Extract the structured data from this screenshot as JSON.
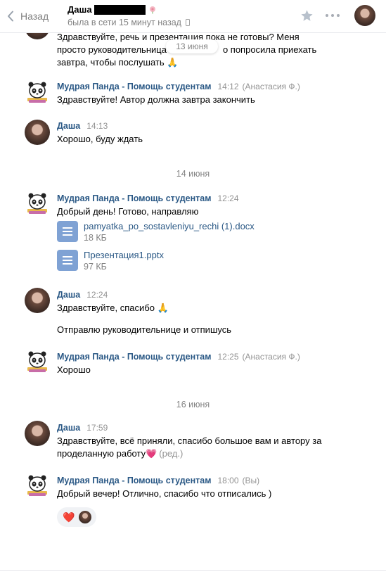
{
  "header": {
    "back_label": "Назад",
    "peer_name": "Даша",
    "status": "была в сети 15 минут назад"
  },
  "floating_date": "13 июня",
  "top_message": {
    "line1": "Здравствуйте, речь и презентация пока не готовы? Меня",
    "line2": "просто руководительница",
    "line2_tail": "о попросила приехать",
    "line3": "завтра, чтобы послушать 🙏"
  },
  "messages": [
    {
      "author": "Мудрая Панда - Помощь студентам",
      "time": "14:12",
      "sub": "(Анастасия Ф.)",
      "text": "Здравствуйте! Автор должна завтра закончить"
    },
    {
      "author": "Даша",
      "time": "14:13",
      "text": "Хорошо, буду ждать"
    },
    {
      "author": "Мудрая Панда - Помощь студентам",
      "time": "12:24",
      "text": "Добрый день! Готово, направляю"
    },
    {
      "author": "Даша",
      "time": "12:24",
      "text": "Здравствуйте, спасибо 🙏",
      "text2": "Отправлю руководительнице и отпишусь"
    },
    {
      "author": "Мудрая Панда - Помощь студентам",
      "time": "12:25",
      "sub": "(Анастасия Ф.)",
      "text": "Хорошо"
    },
    {
      "author": "Даша",
      "time": "17:59",
      "text": "Здравствуйте, всё приняли, спасибо большое вам и автору за",
      "text_line2": "проделанную работу💗",
      "edited": "(ред.)"
    },
    {
      "author": "Мудрая Панда - Помощь студентам",
      "time": "18:00",
      "sub": "(Вы)",
      "text": "Добрый вечер! Отлично, спасибо что отписались )"
    }
  ],
  "dates": [
    "14 июня",
    "16 июня"
  ],
  "documents": [
    {
      "name": "pamyatka_po_sostavleniyu_rechi (1).docx",
      "size": "18 КБ"
    },
    {
      "name": "Презентация1.pptx",
      "size": "97 КБ"
    }
  ],
  "reaction": "❤️"
}
